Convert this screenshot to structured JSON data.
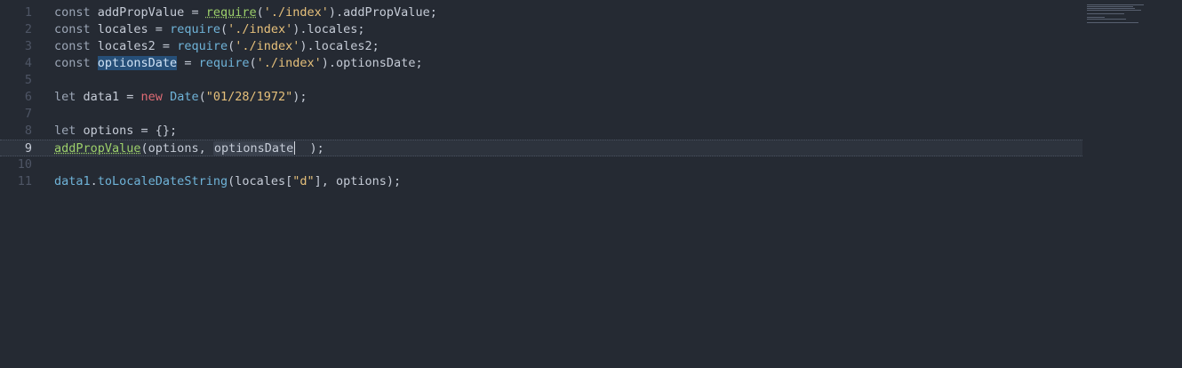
{
  "editor": {
    "lines": [
      {
        "number": "1",
        "tokens": [
          {
            "t": "const ",
            "c": "kw"
          },
          {
            "t": "addPropValue = ",
            "c": ""
          },
          {
            "t": "require",
            "c": "req"
          },
          {
            "t": "(",
            "c": ""
          },
          {
            "t": "'./index'",
            "c": "str"
          },
          {
            "t": ").addPropValue;",
            "c": ""
          }
        ]
      },
      {
        "number": "2",
        "tokens": [
          {
            "t": "const ",
            "c": "kw"
          },
          {
            "t": "locales = ",
            "c": ""
          },
          {
            "t": "require",
            "c": "fn"
          },
          {
            "t": "(",
            "c": ""
          },
          {
            "t": "'./index'",
            "c": "str"
          },
          {
            "t": ").locales;",
            "c": ""
          }
        ]
      },
      {
        "number": "3",
        "tokens": [
          {
            "t": "const ",
            "c": "kw"
          },
          {
            "t": "locales2 = ",
            "c": ""
          },
          {
            "t": "require",
            "c": "fn"
          },
          {
            "t": "(",
            "c": ""
          },
          {
            "t": "'./index'",
            "c": "str"
          },
          {
            "t": ").locales2;",
            "c": ""
          }
        ]
      },
      {
        "number": "4",
        "tokens": [
          {
            "t": "const ",
            "c": "kw"
          },
          {
            "t": "optionsDate",
            "c": "hl-sel"
          },
          {
            "t": " = ",
            "c": ""
          },
          {
            "t": "require",
            "c": "fn"
          },
          {
            "t": "(",
            "c": ""
          },
          {
            "t": "'./index'",
            "c": "str"
          },
          {
            "t": ").optionsDate;",
            "c": ""
          }
        ]
      },
      {
        "number": "5",
        "tokens": []
      },
      {
        "number": "6",
        "tokens": [
          {
            "t": "let ",
            "c": "kw"
          },
          {
            "t": "data1 = ",
            "c": ""
          },
          {
            "t": "new ",
            "c": "red"
          },
          {
            "t": "Date",
            "c": "fn"
          },
          {
            "t": "(",
            "c": ""
          },
          {
            "t": "\"01/28/1972\"",
            "c": "str"
          },
          {
            "t": ");",
            "c": ""
          }
        ]
      },
      {
        "number": "7",
        "tokens": []
      },
      {
        "number": "8",
        "tokens": [
          {
            "t": "let ",
            "c": "kw"
          },
          {
            "t": "options = {};",
            "c": ""
          }
        ]
      },
      {
        "number": "9",
        "current": true,
        "tokens": [
          {
            "t": "addPropValue",
            "c": "req"
          },
          {
            "t": "(options, ",
            "c": ""
          },
          {
            "t": "optionsDate",
            "c": "hl-arg"
          },
          {
            "t": "",
            "c": "caret"
          },
          {
            "t": "  );",
            "c": ""
          }
        ]
      },
      {
        "number": "10",
        "tokens": []
      },
      {
        "number": "11",
        "tokens": [
          {
            "t": "data1",
            "c": "fn"
          },
          {
            "t": ".",
            "c": ""
          },
          {
            "t": "toLocaleDateString",
            "c": "fn"
          },
          {
            "t": "(locales[",
            "c": ""
          },
          {
            "t": "\"d\"",
            "c": "str"
          },
          {
            "t": "], options);",
            "c": ""
          }
        ]
      }
    ]
  }
}
